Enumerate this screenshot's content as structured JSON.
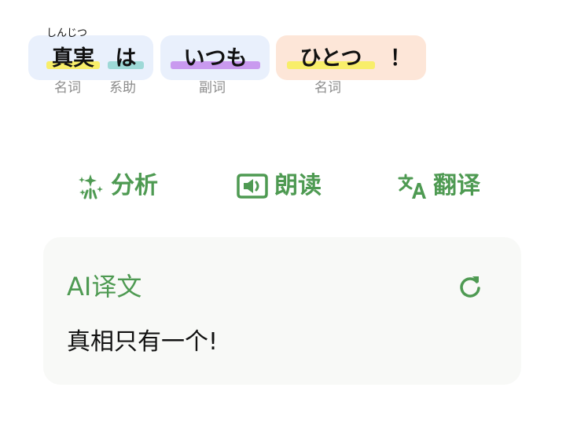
{
  "sentence": {
    "ruby": "しんじつ",
    "words": [
      {
        "text": "真実",
        "highlight": "#f8ee6a"
      },
      {
        "text": "は",
        "highlight": "#9ed9d7"
      },
      {
        "text": "いつも",
        "highlight": "#c99aef"
      },
      {
        "text": "ひとつ",
        "highlight": "#f8ee6a"
      },
      {
        "text": "！",
        "highlight": ""
      }
    ],
    "chip_colors": {
      "blue": "#e9f0fc",
      "orange": "#fde6d8"
    },
    "pos_labels": [
      "名词",
      "系助",
      "副词",
      "名词"
    ]
  },
  "actions": [
    {
      "label": "分析",
      "icon": "sparkle-icon"
    },
    {
      "label": "朗读",
      "icon": "speaker-icon"
    },
    {
      "label": "翻译",
      "icon": "translate-icon"
    }
  ],
  "ai_card": {
    "title": "AI译文",
    "refresh_icon": "refresh-icon",
    "text": "真相只有一个!"
  },
  "colors": {
    "accent": "#4e9a52",
    "pos_label": "#8b8b8b",
    "card_bg": "#f8f9f7"
  }
}
